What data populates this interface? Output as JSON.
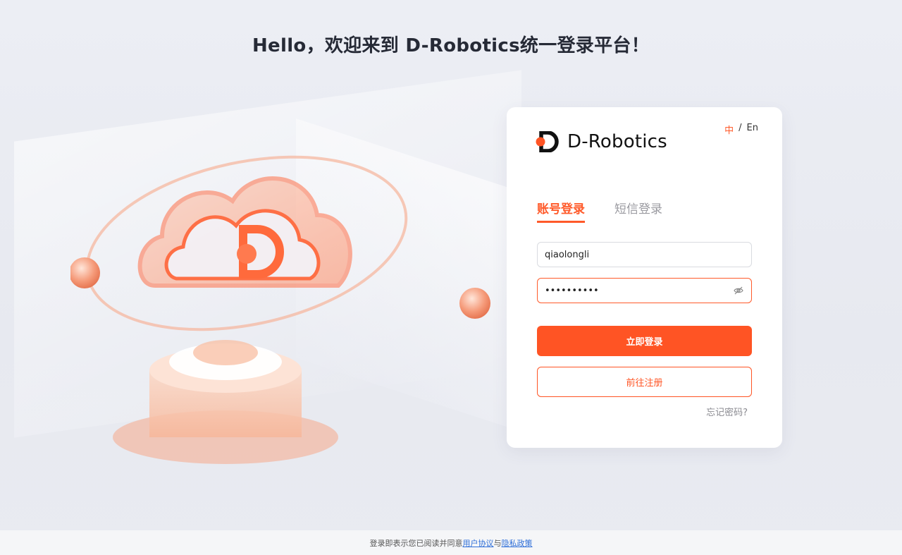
{
  "headline": "Hello，欢迎来到 D-Robotics统一登录平台！",
  "lang": {
    "zh": "中",
    "sep": "/",
    "en": "En"
  },
  "brand": {
    "name": "D-Robotics"
  },
  "tabs": [
    {
      "label": "账号登录",
      "active": true
    },
    {
      "label": "短信登录",
      "active": false
    }
  ],
  "form": {
    "username_value": "qiaolongli",
    "password_value": "••••••••••"
  },
  "buttons": {
    "login": "立即登录",
    "register": "前往注册",
    "forgot": "忘记密码?"
  },
  "footer": {
    "prefix": "登录即表示您已阅读并同意",
    "agreement": "用户协议",
    "and": "与",
    "privacy": "隐私政策"
  },
  "colors": {
    "accent": "#ff5424",
    "link": "#2f6fd8"
  }
}
